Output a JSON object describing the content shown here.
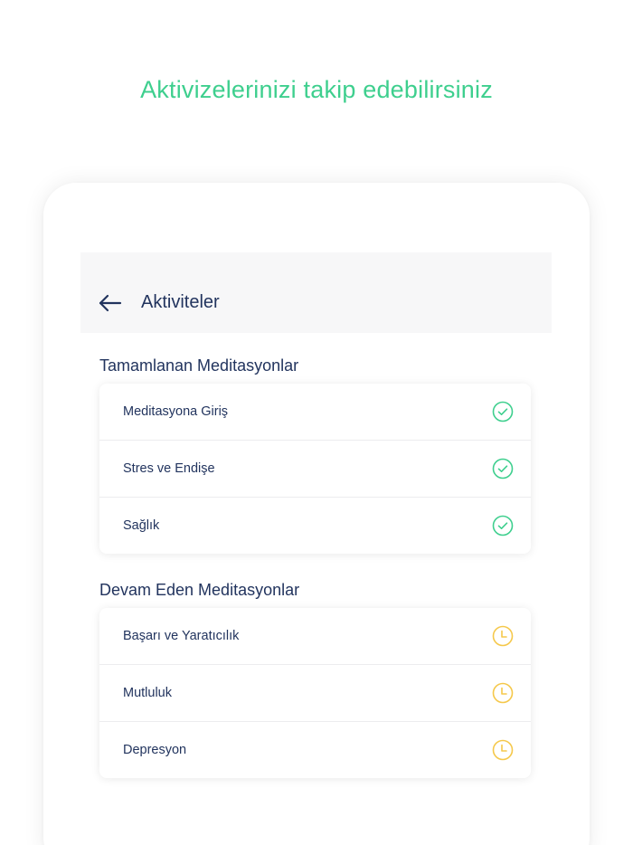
{
  "headline": "Aktivizelerinizi takip edebilirsiniz",
  "header": {
    "title": "Aktiviteler",
    "back_icon": "arrow-left-icon"
  },
  "sections": [
    {
      "title": "Tamamlanan Meditasyonlar",
      "status_icon": "check-circle-icon",
      "items": [
        {
          "label": "Meditasyona Giriş"
        },
        {
          "label": "Stres ve Endişe"
        },
        {
          "label": "Sağlık"
        }
      ]
    },
    {
      "title": "Devam Eden Meditasyonlar",
      "status_icon": "clock-icon",
      "items": [
        {
          "label": "Başarı ve Yaratıcılık"
        },
        {
          "label": "Mutluluk"
        },
        {
          "label": "Depresyon"
        }
      ]
    }
  ],
  "colors": {
    "accent_green": "#3ecf8e",
    "in_progress_yellow": "#f5c84b",
    "text_navy": "#22345e",
    "header_bg": "#f7f7f8"
  }
}
